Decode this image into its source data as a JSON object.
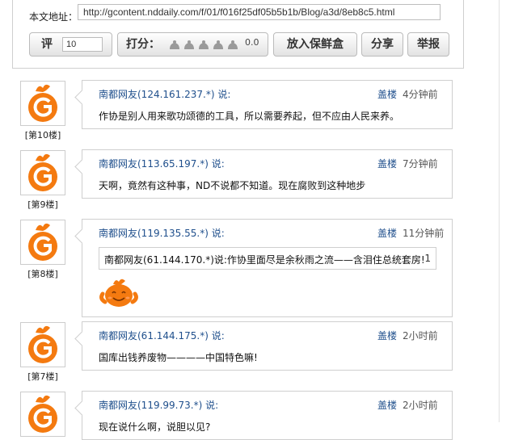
{
  "article_url": {
    "label": "本文地址：",
    "value": "http://gcontent.nddaily.com/f/01/f016f25df05b5b1b/Blog/a3d/8eb8c5.html"
  },
  "toolbar": {
    "score_label": "评",
    "score_value": "10",
    "rate_label": "打分：",
    "rate_value": "0.0",
    "star_count": 5,
    "keep_label": "放入保鲜盒",
    "share_label": "分享",
    "report_label": "举报"
  },
  "colors": {
    "author_link": "#1f4f8c",
    "avatar_orange": "#f47a10",
    "border": "#cfcfcf"
  },
  "comments": [
    {
      "floor": "[第10楼]",
      "author": "南都网友(124.161.237.*) 说:",
      "floor_link": "盖楼",
      "time": "4分钟前",
      "text": "作协是别人用来歌功颂德的工具，所以需要养起，但不应由人民来养。"
    },
    {
      "floor": "[第9楼]",
      "author": "南都网友(113.65.197.*) 说:",
      "floor_link": "盖楼",
      "time": "7分钟前",
      "text": "天啊，竟然有这种事，ND不说都不知道。现在腐败到这种地步"
    },
    {
      "floor": "[第8楼]",
      "author": "南都网友(119.135.55.*) 说:",
      "floor_link": "盖楼",
      "time": "11分钟前",
      "quote": "南都网友(61.144.170.*)说:作协里面尽是余秋雨之流——含泪住总统套房!",
      "quote_count": "1",
      "emoji": "smiling-orange-emoji"
    },
    {
      "floor": "[第7楼]",
      "author": "南都网友(61.144.175.*) 说:",
      "floor_link": "盖楼",
      "time": "2小时前",
      "text": "国库出钱养废物————中国特色嘛!"
    },
    {
      "floor": "",
      "author": "南都网友(119.99.73.*) 说:",
      "floor_link": "盖楼",
      "time": "2小时前",
      "text": "现在说什么啊，说胆以见?"
    }
  ]
}
